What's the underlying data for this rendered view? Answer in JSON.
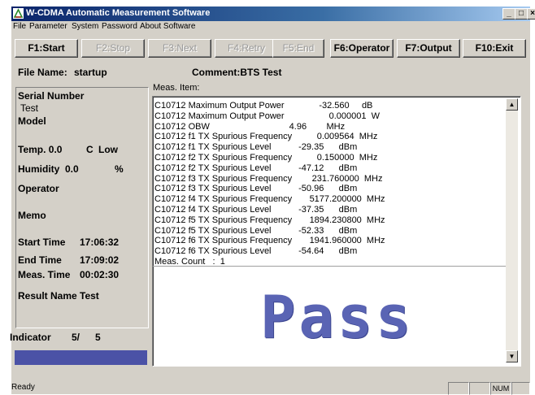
{
  "window": {
    "title": "W-CDMA Automatic Measurement Software",
    "minimize_glyph": "_",
    "maximize_glyph": "□",
    "close_glyph": "×"
  },
  "menu": [
    "File",
    "Parameter",
    "System",
    "Password",
    "About Software"
  ],
  "toolbar": [
    {
      "label": "F1:Start",
      "enabled": true
    },
    {
      "label": "F2:Stop",
      "enabled": false
    },
    {
      "label": "F3:Next",
      "enabled": false
    },
    {
      "label": "F4:Retry",
      "enabled": false
    },
    {
      "label": "F5:End",
      "enabled": false
    },
    {
      "label": "F6:Operator",
      "enabled": true
    },
    {
      "label": "F7:Output",
      "enabled": true
    },
    {
      "label": "F10:Exit",
      "enabled": true
    }
  ],
  "header": {
    "file_name_label": "File Name:",
    "file_name_value": "startup",
    "comment": "Comment:BTS Test",
    "meas_item_label": "Meas. Item:"
  },
  "info": {
    "serial_label": "Serial Number",
    "serial_value": "Test",
    "model_label": "Model",
    "temp": "Temp. 0.0",
    "temp_unit": "C",
    "temp_status": "Low",
    "humidity": "Humidity",
    "humidity_value": "0.0",
    "humidity_unit": "%",
    "operator_label": "Operator",
    "memo_label": "Memo",
    "start_time_label": "Start Time",
    "start_time_value": "17:06:32",
    "end_time_label": "End Time",
    "end_time_value": "17:09:02",
    "meas_time_label": "Meas. Time",
    "meas_time_value": "00:02:30",
    "result_name_label": "Result Name",
    "result_name_value": "Test",
    "indicator_label": "Indicator",
    "indicator_value": "5/",
    "indicator_total": "5"
  },
  "measurements": [
    "C10712 Maximum Output Power              -32.560     dB",
    "C10712 Maximum Output Power                  0.000001  W",
    "C10712 OBW                                4.96        MHz",
    "C10712 f1 TX Spurious Frequency          0.009564  MHz",
    "C10712 f1 TX Spurious Level           -29.35      dBm",
    "C10712 f2 TX Spurious Frequency          0.150000  MHz",
    "C10712 f2 TX Spurious Level           -47.12      dBm",
    "C10712 f3 TX Spurious Frequency        231.760000  MHz",
    "C10712 f3 TX Spurious Level           -50.96      dBm",
    "C10712 f4 TX Spurious Frequency       5177.200000  MHz",
    "C10712 f4 TX Spurious Level           -37.35      dBm",
    "C10712 f5 TX Spurious Frequency       1894.230800  MHz",
    "C10712 f5 TX Spurious Level           -52.33      dBm",
    "C10712 f6 TX Spurious Frequency       1941.960000  MHz",
    "C10712 f6 TX Spurious Level           -54.64      dBm",
    "Meas. Count   :  1"
  ],
  "result": "Pass",
  "scroll": {
    "up": "▲",
    "down": "▼"
  },
  "status": {
    "text": "Ready",
    "num": "NUM"
  },
  "colors": {
    "title_start": "#0a246a",
    "pass_text": "#5a64b4",
    "indicator_bar": "#4b52a6",
    "face": "#d4d0c8"
  }
}
